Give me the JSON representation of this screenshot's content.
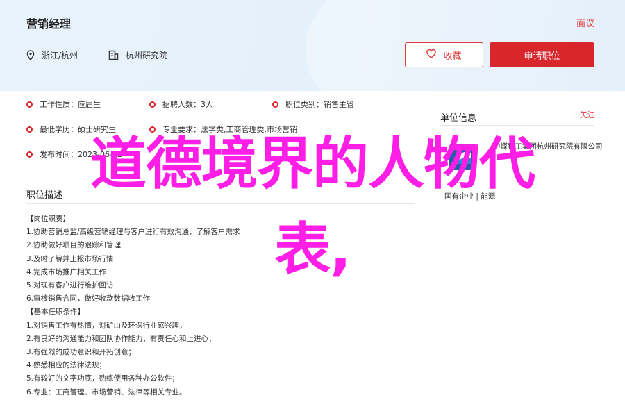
{
  "job": {
    "title": "营销经理",
    "report": "面议",
    "location": "浙江/杭州",
    "company": "杭州研究院",
    "fav_label": "收藏",
    "apply_label": "申请职位"
  },
  "info": {
    "nature_label": "工作性质：",
    "nature": "应届生",
    "hires_label": "招聘人数：",
    "hires": "3人",
    "category_label": "职位类别：",
    "category": "销售主管",
    "edu_label": "最低学历：",
    "edu": "硕士研究生",
    "major_label": "专业要求：",
    "major": "法学类,工商管理类,市场营销",
    "date_label": "发布时间：",
    "date": "2023-06-12"
  },
  "desc": {
    "title": "职位描述",
    "lines": [
      "【岗位职责】",
      "1.协助营销总监/高级营销经理与客户进行有效沟通，了解客户需求",
      "2.协助做好项目的跟踪和管理",
      "3.及时了解并上报市场行情",
      "4.完成市场推广相关工作",
      "5.对现有客户进行维护回访",
      "6.审核销售合同，做好收款数据收工作",
      "【基本任职条件】",
      "1.对销售工作有热情，对矿山及环保行业感兴趣；",
      "2.有良好的沟通能力和团队协作能力，有责任心和上进心；",
      "3.有强烈的成功意识和开拓创意；",
      "4.熟悉相应的法律法规；",
      "5.有较好的文字功底，熟练使用各种办公软件；",
      "6.专业：工商管理、市场营销、法律等相关专业。"
    ]
  },
  "side": {
    "title": "单位信息",
    "follow": "+ 关注",
    "company_name": "中煤科工集团杭州研究院有限公司",
    "tags": "国有企业  |  能源"
  },
  "overlay": {
    "line1": "道德境界的人物代",
    "line2": "表,"
  },
  "colors": {
    "accent": "#d9262c",
    "overlay": "#ff1ee6",
    "header_bg": "#e6f1fa"
  }
}
